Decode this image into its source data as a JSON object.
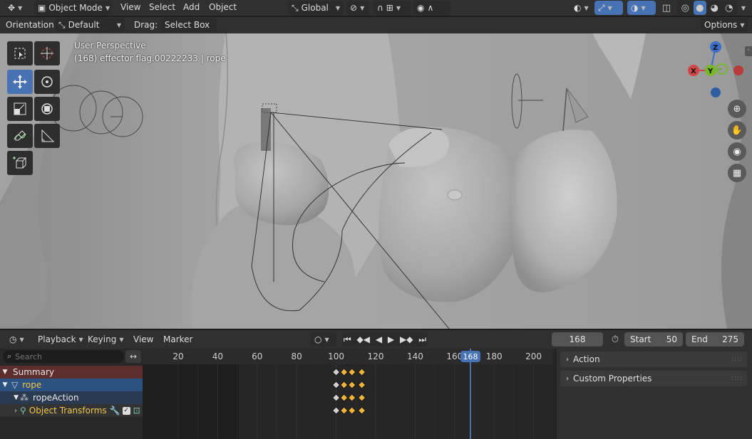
{
  "header": {
    "mode": "Object Mode",
    "menus": [
      "View",
      "Select",
      "Add",
      "Object"
    ],
    "transform_orientation": "Global"
  },
  "tool_settings": {
    "orientation_label": "Orientation:",
    "orientation_value": "Default",
    "drag_label": "Drag:",
    "drag_value": "Select Box",
    "options_label": "Options"
  },
  "viewport": {
    "view_name": "User Perspective",
    "object_info": "(168) effector flag.00222233 | rope",
    "gizmo": {
      "x": "X",
      "y": "Y",
      "z": "Z"
    }
  },
  "timeline_header": {
    "playback": "Playback",
    "keying": "Keying",
    "view": "View",
    "marker": "Marker",
    "current_frame": "168",
    "start_label": "Start",
    "start_value": "50",
    "end_label": "End",
    "end_value": "275"
  },
  "dopesheet": {
    "search_placeholder": "Search",
    "channels": {
      "summary": "Summary",
      "object": "rope",
      "action": "ropeAction",
      "group": "Object Transforms"
    },
    "ruler_ticks": [
      "20",
      "40",
      "60",
      "80",
      "100",
      "120",
      "140",
      "160",
      "180",
      "200"
    ],
    "playhead_label": "168",
    "keyframes": [
      100,
      104,
      108,
      113
    ]
  },
  "sidebar": {
    "panels": [
      "Action",
      "Custom Properties"
    ]
  },
  "colors": {
    "accent": "#4772b3",
    "summary_row": "#5e2e2e",
    "object_row": "#2c5282",
    "group_text": "#f2c94c",
    "keyframe": "#f2b33d"
  }
}
